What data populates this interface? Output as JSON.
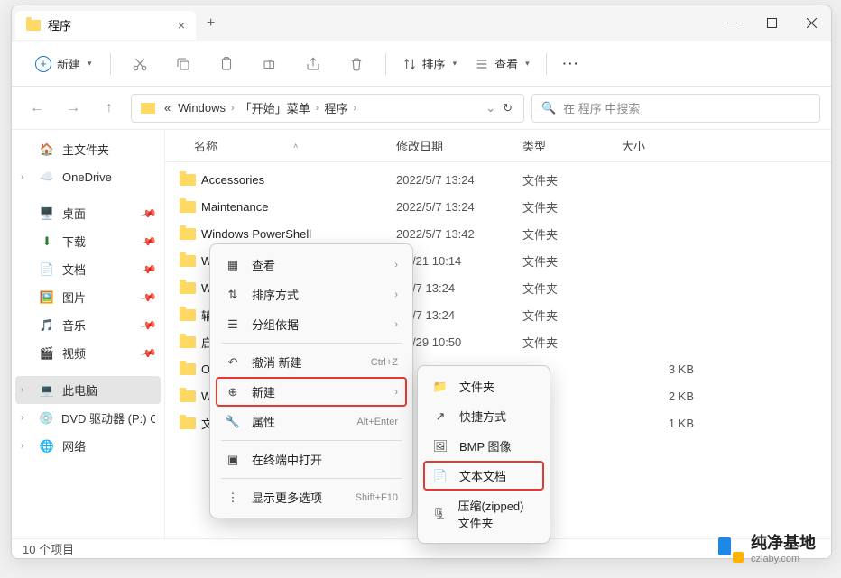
{
  "window": {
    "tab_title": "程序",
    "controls": {
      "min": "—",
      "max": "☐",
      "close": "×"
    }
  },
  "toolbar": {
    "new_label": "新建",
    "sort_label": "排序",
    "view_label": "查看",
    "more": "···"
  },
  "breadcrumb": {
    "prefix": "«",
    "items": [
      "Windows",
      "「开始」菜单",
      "程序"
    ]
  },
  "search": {
    "icon": "🔍",
    "placeholder": "在 程序 中搜索"
  },
  "columns": {
    "name": "名称",
    "date": "修改日期",
    "type": "类型",
    "size": "大小"
  },
  "sidebar": {
    "home": "主文件夹",
    "onedrive": "OneDrive",
    "desktop": "桌面",
    "downloads": "下载",
    "documents": "文档",
    "pictures": "图片",
    "music": "音乐",
    "videos": "视频",
    "thispc": "此电脑",
    "dvd": "DVD 驱动器 (P:) C",
    "network": "网络"
  },
  "rows": [
    {
      "name": "Accessories",
      "date": "2022/5/7 13:24",
      "type": "文件夹",
      "size": ""
    },
    {
      "name": "Maintenance",
      "date": "2022/5/7 13:24",
      "type": "文件夹",
      "size": ""
    },
    {
      "name": "Windows PowerShell",
      "date": "2022/5/7 13:42",
      "type": "文件夹",
      "size": ""
    },
    {
      "name": "Wind",
      "date": "2/9/21 10:14",
      "type": "文件夹",
      "size": ""
    },
    {
      "name": "Wind",
      "date": "2/5/7 13:24",
      "type": "文件夹",
      "size": ""
    },
    {
      "name": "辅助",
      "date": "2/5/7 13:24",
      "type": "文件夹",
      "size": ""
    },
    {
      "name": "启动",
      "date": "3/1/29 10:50",
      "type": "文件夹",
      "size": ""
    },
    {
      "name": "Onel",
      "date": "",
      "type": "",
      "size": "3 KB"
    },
    {
      "name": "Wind",
      "date": "",
      "type": "",
      "size": "2 KB"
    },
    {
      "name": "文件",
      "date": "",
      "type": "",
      "size": "1 KB"
    }
  ],
  "context_menu": {
    "view": "查看",
    "sort": "排序方式",
    "group": "分组依据",
    "undo": "撤消 新建",
    "undo_key": "Ctrl+Z",
    "new": "新建",
    "properties": "属性",
    "properties_key": "Alt+Enter",
    "terminal": "在终端中打开",
    "more": "显示更多选项",
    "more_key": "Shift+F10"
  },
  "submenu": {
    "folder": "文件夹",
    "shortcut": "快捷方式",
    "bmp": "BMP 图像",
    "text": "文本文档",
    "zip": "压缩(zipped)文件夹"
  },
  "status": "10 个项目",
  "watermark": {
    "t1": "纯净基地",
    "t2": "czlaby.com"
  }
}
